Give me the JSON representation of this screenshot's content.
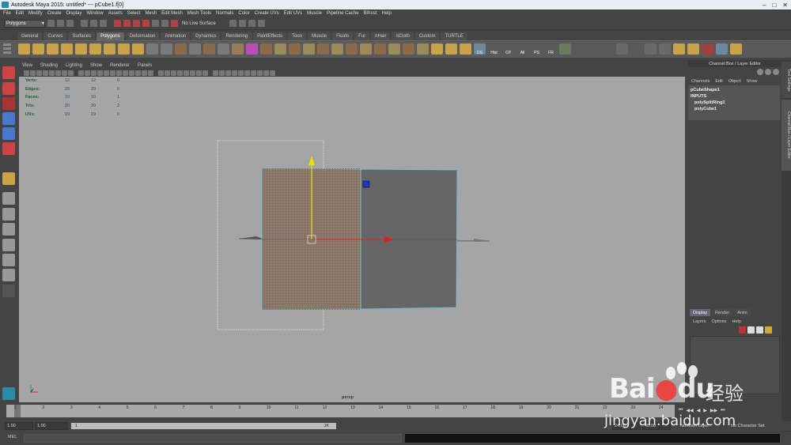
{
  "title": "Autodesk Maya 2015: untitled*   ---   pCube1.f[0]",
  "menubar": [
    "File",
    "Edit",
    "Modify",
    "Create",
    "Display",
    "Window",
    "Assets",
    "Select",
    "Mesh",
    "Edit Mesh",
    "Mesh Tools",
    "Normals",
    "Color",
    "Create UVs",
    "Edit UVs",
    "Muscle",
    "Pipeline Cache",
    "Bifrost",
    "Help"
  ],
  "statusline": {
    "menuset": "Polygons",
    "live_surface": "No Live Surface"
  },
  "shelf_tabs": [
    "General",
    "Curves",
    "Surfaces",
    "Polygons",
    "Deformation",
    "Animation",
    "Dynamics",
    "Rendering",
    "PaintEffects",
    "Toon",
    "Muscle",
    "Fluids",
    "Fur",
    "nHair",
    "nCloth",
    "Custom",
    "TURTLE"
  ],
  "shelf_active": "Polygons",
  "shelf_icon_labels": {
    "ds": "DS",
    "hist": "Hist",
    "cp": "CP",
    "all": "All",
    "ps": "PS",
    "fr": "FR"
  },
  "viewport_menu": [
    "View",
    "Shading",
    "Lighting",
    "Show",
    "Renderer",
    "Panels"
  ],
  "hud": [
    {
      "key": "Verts:",
      "v1": "12",
      "v2": "12",
      "v3": "0"
    },
    {
      "key": "Edges:",
      "v1": "20",
      "v2": "20",
      "v3": "0"
    },
    {
      "key": "Faces:",
      "v1": "10",
      "v2": "10",
      "v3": "1"
    },
    {
      "key": "Tris:",
      "v1": "20",
      "v2": "20",
      "v3": "2"
    },
    {
      "key": "UVs:",
      "v1": "19",
      "v2": "19",
      "v3": "0"
    }
  ],
  "camera_label": "persp",
  "channel_box": {
    "header": "Channel Box / Layer Editor",
    "menu": [
      "Channels",
      "Edit",
      "Object",
      "Show"
    ],
    "shape": "pCubeShape1",
    "inputs_label": "INPUTS",
    "inputs": [
      "polySplitRing1",
      "polyCube1"
    ]
  },
  "side_tabs": [
    "Tool Settings",
    "Channel Box / Layer Editor"
  ],
  "layer_editor": {
    "tabs": [
      "Display",
      "Render",
      "Anim"
    ],
    "menu": [
      "Layers",
      "Options",
      "Help"
    ]
  },
  "timeline": {
    "ticks": [
      "1",
      "2",
      "3",
      "4",
      "5",
      "6",
      "7",
      "8",
      "9",
      "10",
      "11",
      "12",
      "13",
      "14",
      "15",
      "16",
      "17",
      "18",
      "19",
      "20",
      "21",
      "22",
      "23",
      "24"
    ],
    "current": "1"
  },
  "range": {
    "start_field": "1.00",
    "start_field2": "1.00",
    "slider_start": "1",
    "slider_end": "24",
    "end_field": "24.00",
    "end_field2": "48.00",
    "anim_layer": "No Anim Layer",
    "char_set": "No Character Set"
  },
  "command": {
    "label": "MEL"
  },
  "watermark": {
    "brand": "Bai",
    "brand2": "du",
    "cn": "经验",
    "url": "jingyan.baidu.com"
  },
  "colors": {
    "viewport_bg": "#a5a5a5",
    "selected_face": "#8d7b6e",
    "mesh_face": "#666666",
    "mesh_edge": "#6cc8e0"
  }
}
